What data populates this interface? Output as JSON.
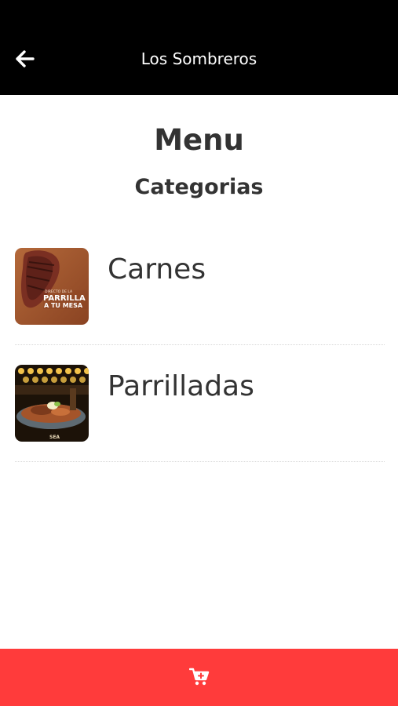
{
  "app_bar": {
    "title": "Los Sombreros",
    "back_icon": "arrow-left-icon"
  },
  "main": {
    "heading": "Menu",
    "subheading": "Categorias",
    "categories": [
      {
        "label": "Carnes",
        "thumbnail_text_line1": "PARRILLA",
        "thumbnail_text_line2": "A TU MESA",
        "thumbnail_small_text": "DIRECTO DE LA"
      },
      {
        "label": "Parrilladas",
        "thumbnail_text_line1": "SEA"
      }
    ]
  },
  "bottom_bar": {
    "icon": "cart-plus-icon"
  },
  "colors": {
    "app_bar": "#000000",
    "accent": "#ff3b3b",
    "text": "#333333"
  }
}
